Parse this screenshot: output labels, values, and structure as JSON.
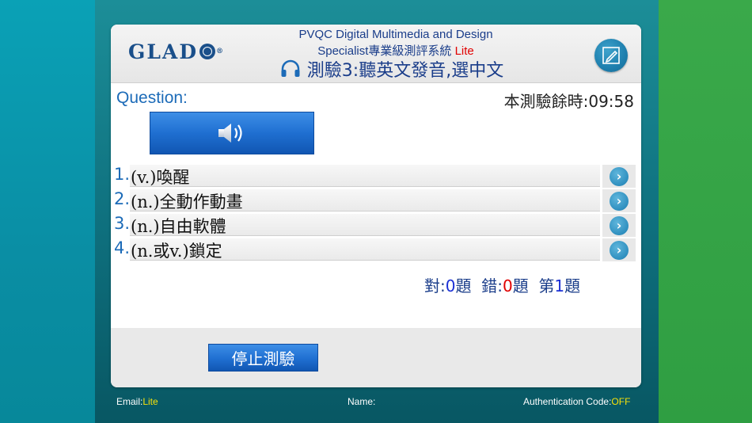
{
  "header": {
    "logo_text": "GLAD",
    "title_line1": "PVQC Digital Multimedia and Design",
    "title_line2_prefix": "Specialist專業級測評系統 ",
    "title_line2_badge": "Lite",
    "test_title": "測驗3:聽英文發音,選中文",
    "edit_icon": "pencil-note-icon",
    "headphone_icon": "headphones-icon"
  },
  "question": {
    "label": "Question:",
    "timer_label": "本測驗餘時:",
    "timer_value": "09:58",
    "play_icon": "speaker-icon"
  },
  "options": [
    {
      "number": "1.",
      "text": "(v.)喚醒"
    },
    {
      "number": "2.",
      "text": "(n.)全動作動畫"
    },
    {
      "number": "3.",
      "text": "(n.)自由軟體"
    },
    {
      "number": "4.",
      "text": "(n.或v.)鎖定"
    }
  ],
  "score": {
    "correct_label": "對:",
    "correct_value": "0",
    "correct_suffix": "題",
    "wrong_label": "錯:",
    "wrong_value": "0",
    "wrong_suffix": "題",
    "question_prefix": "第",
    "question_value": "1",
    "question_suffix": "題"
  },
  "actions": {
    "stop_label": "停止測驗"
  },
  "status_bar": {
    "email_label": "Email:",
    "email_value": "Lite",
    "name_label": "Name:",
    "auth_label": "Authentication Code:",
    "auth_value": "OFF"
  },
  "colors": {
    "accent_blue": "#1f6fd1",
    "title_blue": "#1a3d8a",
    "lite_red": "#e10000",
    "status_yellow": "#f6e00a"
  }
}
